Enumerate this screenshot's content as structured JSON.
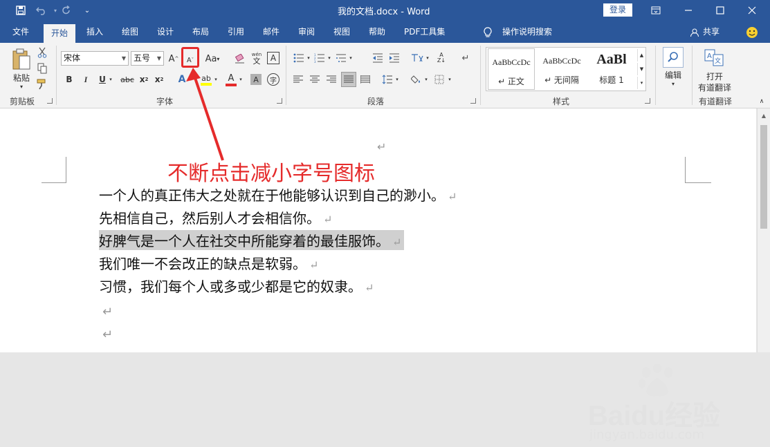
{
  "window": {
    "title": "我的文档.docx - Word",
    "login_label": "登录"
  },
  "tabs": [
    {
      "label": "文件"
    },
    {
      "label": "开始"
    },
    {
      "label": "插入"
    },
    {
      "label": "绘图"
    },
    {
      "label": "设计"
    },
    {
      "label": "布局"
    },
    {
      "label": "引用"
    },
    {
      "label": "邮件"
    },
    {
      "label": "审阅"
    },
    {
      "label": "视图"
    },
    {
      "label": "帮助"
    },
    {
      "label": "PDF工具集"
    }
  ],
  "tell_me": "操作说明搜索",
  "share_label": "共享",
  "ribbon": {
    "clipboard": {
      "paste_label": "粘贴",
      "group_label": "剪贴板"
    },
    "font": {
      "font_name": "宋体",
      "font_size": "五号",
      "group_label": "字体"
    },
    "paragraph": {
      "group_label": "段落"
    },
    "styles": {
      "group_label": "样式",
      "items": [
        {
          "preview": "AaBbCcDc",
          "name": "↵ 正文"
        },
        {
          "preview": "AaBbCcDc",
          "name": "↵ 无间隔"
        },
        {
          "preview": "AaBl",
          "name": "标题 1"
        }
      ]
    },
    "editing": {
      "label": "编辑"
    },
    "translate": {
      "label_line1": "打开",
      "label_line2": "有道翻译",
      "group_label": "有道翻译"
    }
  },
  "annotation": "不断点击减小字号图标",
  "document": {
    "paragraphs": [
      "一个人的真正伟大之处就在于他能够认识到自己的渺小。",
      "先相信自己，然后别人才会相信你。",
      "好脾气是一个人在社交中所能穿着的最佳服饰。",
      "我们唯一不会改正的缺点是软弱。",
      "习惯，我们每个人或多或少都是它的奴隶。"
    ],
    "return_mark": "↵"
  },
  "watermark": {
    "text": "Baidu经验",
    "url": "jingyan.baidu.com"
  },
  "colors": {
    "brand": "#2b579a",
    "annotation": "#e52b2b",
    "selection": "#d0d0d0"
  }
}
